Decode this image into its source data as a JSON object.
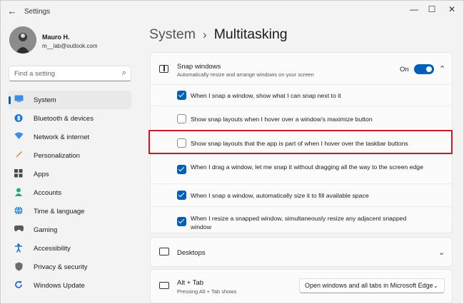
{
  "titlebar": {
    "app_title": "Settings",
    "back_glyph": "←",
    "minimize_glyph": "—",
    "maximize_glyph": "☐",
    "close_glyph": "✕"
  },
  "user": {
    "name": "Mauro H.",
    "email": "m__lab@outlook.com"
  },
  "search": {
    "placeholder": "Find a setting",
    "icon": "search-icon"
  },
  "sidebar": {
    "items": [
      {
        "label": "System",
        "icon": "system-icon",
        "active": true
      },
      {
        "label": "Bluetooth & devices",
        "icon": "bluetooth-icon"
      },
      {
        "label": "Network & internet",
        "icon": "wifi-icon"
      },
      {
        "label": "Personalization",
        "icon": "brush-icon"
      },
      {
        "label": "Apps",
        "icon": "apps-icon"
      },
      {
        "label": "Accounts",
        "icon": "person-icon"
      },
      {
        "label": "Time & language",
        "icon": "globe-icon"
      },
      {
        "label": "Gaming",
        "icon": "gamepad-icon"
      },
      {
        "label": "Accessibility",
        "icon": "accessibility-icon"
      },
      {
        "label": "Privacy & security",
        "icon": "shield-icon"
      },
      {
        "label": "Windows Update",
        "icon": "update-icon"
      }
    ]
  },
  "breadcrumb": {
    "parent": "System",
    "separator": "›",
    "current": "Multitasking"
  },
  "snap": {
    "title": "Snap windows",
    "description": "Automatically resize and arrange windows on your screen",
    "toggle_label": "On",
    "toggle_on": true,
    "options": [
      {
        "label": "When I snap a window, show what I can snap next to it",
        "checked": true
      },
      {
        "label": "Show snap layouts when I hover over a window's maximize button",
        "checked": false
      },
      {
        "label": "Show snap layouts that the app is part of when I hover over the taskbar buttons",
        "checked": false,
        "highlighted": true
      },
      {
        "label": "When I drag a window, let me snap it without dragging all the way to the screen edge",
        "checked": true
      },
      {
        "label": "When I snap a window, automatically size it to fill available space",
        "checked": true
      },
      {
        "label": "When I resize a snapped window, simultaneously resize any adjacent snapped window",
        "checked": true
      }
    ]
  },
  "desktops": {
    "title": "Desktops"
  },
  "alt_tab": {
    "title": "Alt + Tab",
    "description": "Pressing Alt + Tab shows",
    "selected": "Open windows and all tabs in Microsoft Edge"
  },
  "colors": {
    "accent": "#005fb8",
    "highlight_border": "#c41e24"
  }
}
